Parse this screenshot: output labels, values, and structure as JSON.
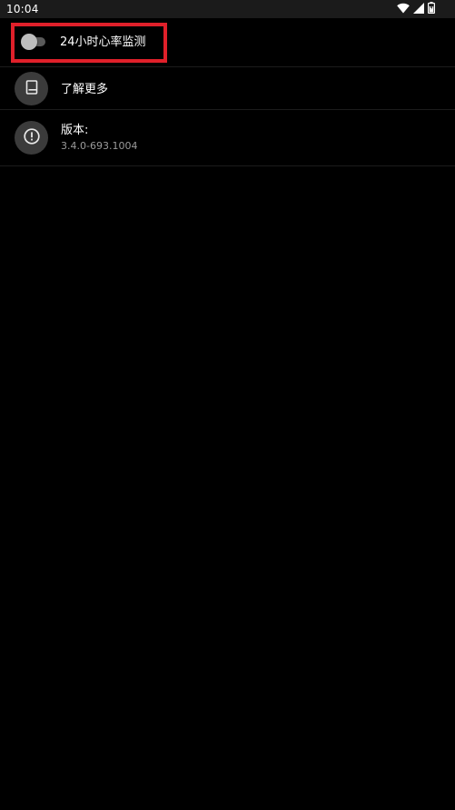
{
  "status_bar": {
    "time": "10:04",
    "icons": [
      "wifi-icon",
      "cellular-signal-icon",
      "battery-icon"
    ]
  },
  "settings": {
    "heart_rate_toggle": {
      "label": "24小时心率监测",
      "enabled": false,
      "highlight_color": "#e0202a"
    },
    "learn_more": {
      "label": "了解更多",
      "icon": "book-icon"
    },
    "version": {
      "label": "版本:",
      "value": "3.4.0-693.1004",
      "icon": "info-icon"
    }
  },
  "colors": {
    "background": "#000000",
    "status_bar": "#1b1b1b",
    "icon_circle": "#3b3b3b",
    "text_primary": "#ffffff",
    "text_secondary": "#9a9a9a"
  }
}
